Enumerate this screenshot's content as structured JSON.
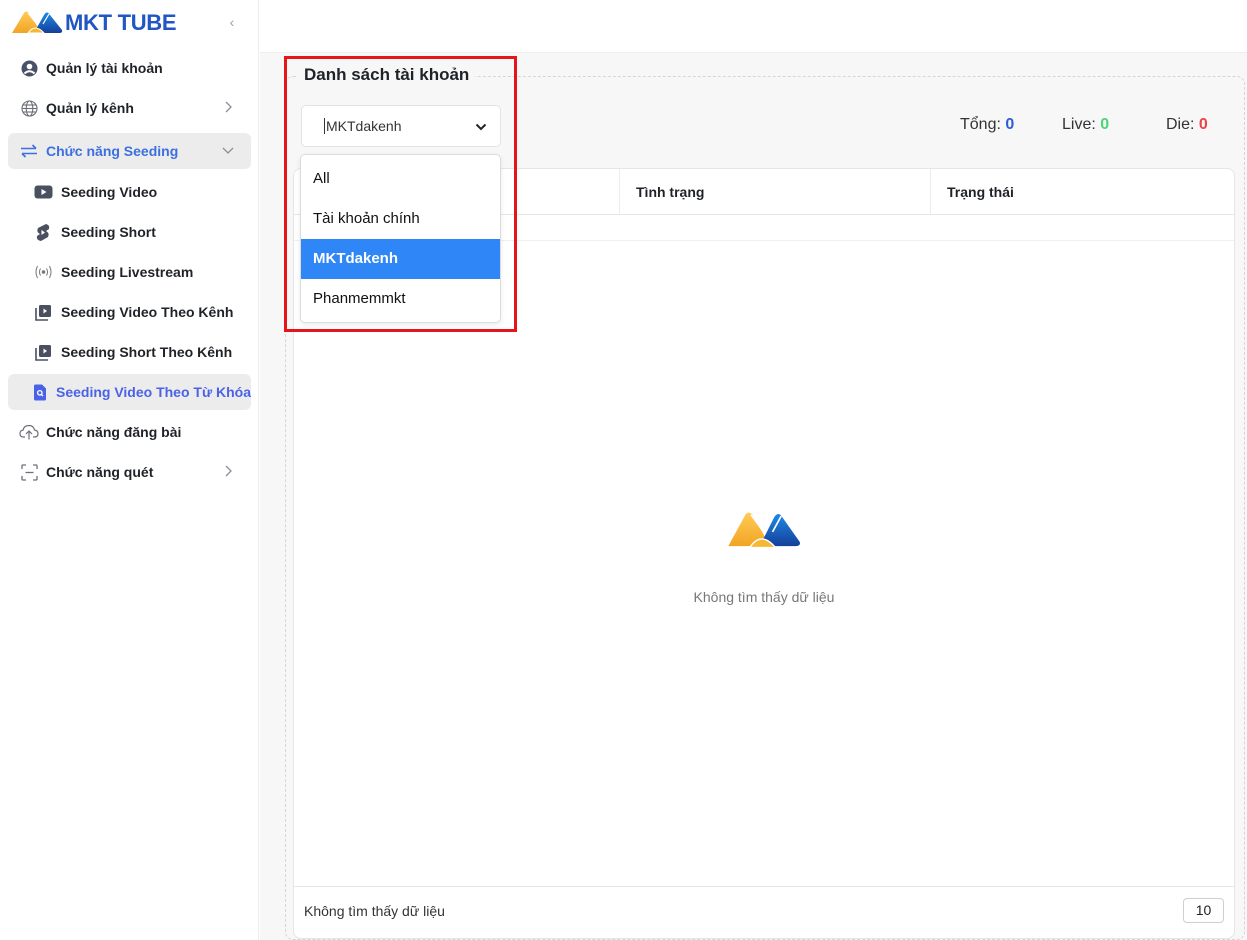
{
  "app": {
    "brand": "MKT TUBE",
    "brand_color": "#2156c4"
  },
  "sidebar": {
    "collapse_icon": "chevron-left-icon",
    "items": [
      {
        "label": "Quản lý tài khoản",
        "icon": "user-circle-icon"
      },
      {
        "label": "Quản lý kênh",
        "icon": "globe-icon",
        "chevron": "chevron-right-icon"
      },
      {
        "label": "Chức năng Seeding",
        "icon": "swap-arrows-icon",
        "chevron": "chevron-down-icon",
        "expanded": true
      },
      {
        "label": "Seeding Video",
        "icon": "youtube-play-icon"
      },
      {
        "label": "Seeding Short",
        "icon": "shorts-icon"
      },
      {
        "label": "Seeding Livestream",
        "icon": "broadcast-icon"
      },
      {
        "label": "Seeding Video Theo Kênh",
        "icon": "playlist-play-icon"
      },
      {
        "label": "Seeding Short Theo Kênh",
        "icon": "playlist-play-icon"
      },
      {
        "label": "Seeding Video Theo Từ Khóa",
        "icon": "file-search-icon",
        "active": true
      },
      {
        "label": "Chức năng đăng bài",
        "icon": "cloud-upload-icon"
      },
      {
        "label": "Chức năng quét",
        "icon": "scan-icon",
        "chevron": "chevron-right-icon"
      }
    ]
  },
  "panel": {
    "title": "Danh sách tài khoản",
    "select": {
      "value": "MKTdakenh",
      "options": [
        "All",
        "Tài khoản chính",
        "MKTdakenh",
        "Phanmemmkt"
      ],
      "selected_index": 2
    },
    "stats": {
      "total_label": "Tổng:",
      "total_value": "0",
      "total_color": "#2f5bd8",
      "live_label": "Live:",
      "live_value": "0",
      "live_color": "#4cd37a",
      "die_label": "Die:",
      "die_value": "0",
      "die_color": "#f0404a"
    },
    "table": {
      "columns": [
        "",
        "Tình trạng",
        "Trạng thái"
      ],
      "empty_text": "Không tìm thấy dữ liệu",
      "footer_text": "Không tìm thấy dữ liệu",
      "page_size": "10"
    }
  },
  "colors": {
    "active_text": "#4a63e6",
    "selected_option_bg": "#2f86f6",
    "highlight_border": "#e8141b"
  }
}
